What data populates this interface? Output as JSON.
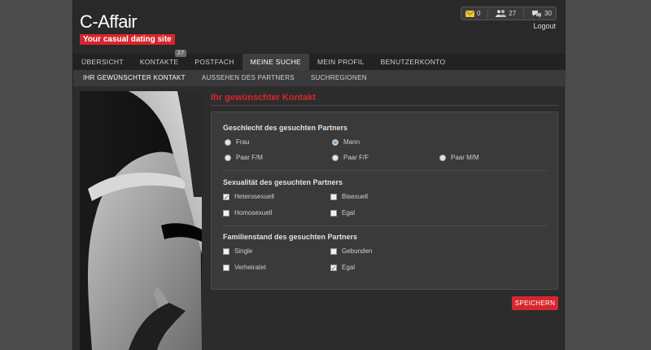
{
  "brand": {
    "logo": "C-Affair",
    "tagline": "Your casual dating site"
  },
  "topbar": {
    "messages_count": "0",
    "contacts_count": "27",
    "chat_count": "30",
    "logout": "Logout"
  },
  "nav": {
    "items": [
      {
        "label": "ÜBERSICHT"
      },
      {
        "label": "KONTAKTE",
        "badge": "27"
      },
      {
        "label": "POSTFACH"
      },
      {
        "label": "MEINE SUCHE"
      },
      {
        "label": "MEIN PROFIL"
      },
      {
        "label": "BENUTZERKONTO"
      }
    ]
  },
  "subnav": {
    "items": [
      {
        "label": "IHR GEWÜNSCHTER KONTAKT"
      },
      {
        "label": "AUSSEHEN DES PARTNERS"
      },
      {
        "label": "SUCHREGIONEN"
      }
    ]
  },
  "main": {
    "title": "Ihr gewünschter Kontakt",
    "gender": {
      "heading": "Geschlecht des gesuchten Partners",
      "options": [
        {
          "label": "Frau",
          "checked": false
        },
        {
          "label": "Mann",
          "checked": true
        },
        {
          "label": "Paar F/M",
          "checked": false
        },
        {
          "label": "Paar F/F",
          "checked": false
        },
        {
          "label": "Paar M/M",
          "checked": false
        }
      ]
    },
    "sexuality": {
      "heading": "Sexualität des gesuchten Partners",
      "options": [
        {
          "label": "Heterosexuell",
          "checked": true
        },
        {
          "label": "Bisexuell",
          "checked": false
        },
        {
          "label": "Homosexuell",
          "checked": false
        },
        {
          "label": "Egal",
          "checked": false
        }
      ]
    },
    "status": {
      "heading": "Familienstand des gesuchten Partners",
      "options": [
        {
          "label": "Single",
          "checked": false
        },
        {
          "label": "Gebunden",
          "checked": false
        },
        {
          "label": "Verheiratet",
          "checked": false
        },
        {
          "label": "Egal",
          "checked": true
        }
      ]
    },
    "save_label": "SPEICHERN"
  },
  "colors": {
    "accent": "#d7262d",
    "background": "#2c2c2c",
    "panel": "#3a3a3a"
  }
}
